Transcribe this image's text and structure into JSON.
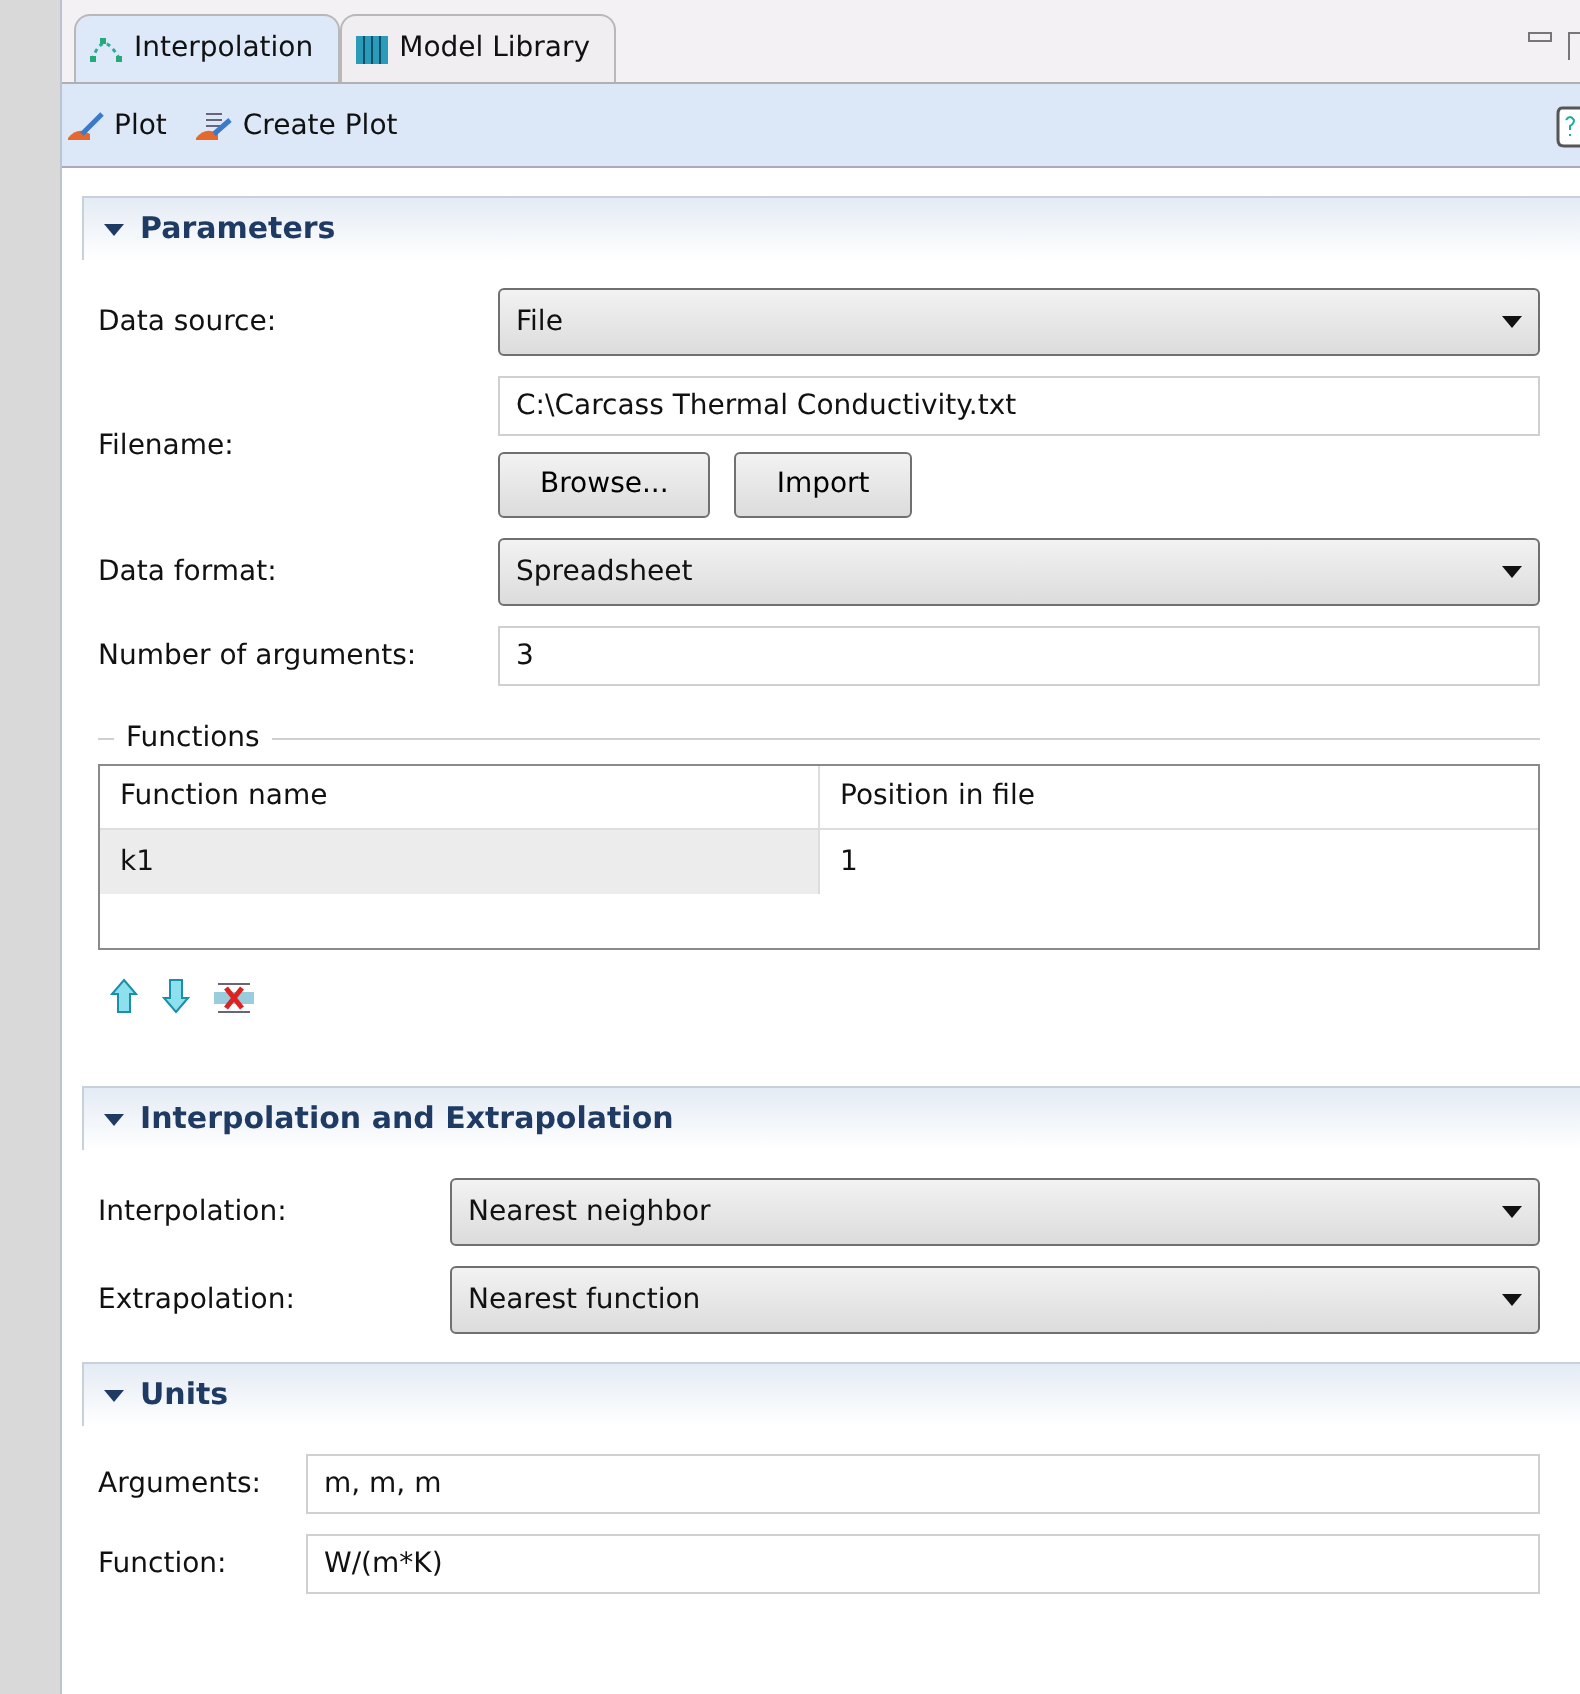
{
  "tabs": [
    {
      "label": "Interpolation",
      "selected": true
    },
    {
      "label": "Model Library",
      "selected": false
    }
  ],
  "toolbar": [
    {
      "label": "Plot"
    },
    {
      "label": "Create Plot"
    }
  ],
  "sections": [
    {
      "title": "Parameters",
      "expanded": true,
      "rows": [
        {
          "kind": "select",
          "label": "Data source:",
          "value": "File"
        },
        {
          "kind": "file",
          "label": "Filename:",
          "value": "C:\\Carcass Thermal Conductivity.txt",
          "buttons": [
            "Browse...",
            "Import"
          ]
        },
        {
          "kind": "select",
          "label": "Data format:",
          "value": "Spreadsheet"
        },
        {
          "kind": "text",
          "label": "Number of arguments:",
          "value": "3"
        },
        {
          "kind": "table",
          "legend": "Functions",
          "columns": [
            "Function name",
            "Position in file"
          ],
          "rows": [
            {
              "cells": [
                "k1",
                "1"
              ],
              "selected": true
            }
          ]
        }
      ]
    },
    {
      "title": "Interpolation and Extrapolation",
      "expanded": true,
      "rows": [
        {
          "kind": "select",
          "label": "Interpolation:",
          "value": "Nearest neighbor"
        },
        {
          "kind": "select",
          "label": "Extrapolation:",
          "value": "Nearest function"
        }
      ]
    },
    {
      "title": "Units",
      "expanded": true,
      "rows": [
        {
          "kind": "text",
          "label": "Arguments:",
          "value": "m, m, m"
        },
        {
          "kind": "text",
          "label": "Function:",
          "value": "W/(m*K)"
        }
      ]
    }
  ]
}
